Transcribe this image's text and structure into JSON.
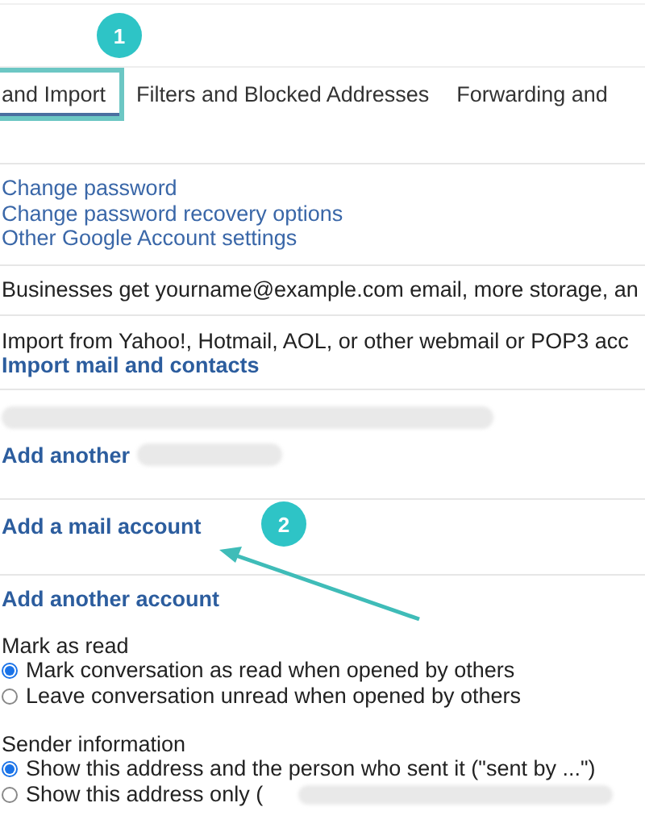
{
  "annotations": [
    {
      "label": "1"
    },
    {
      "label": "2"
    }
  ],
  "tabs": [
    {
      "label": "and Import",
      "selected": true
    },
    {
      "label": "Filters and Blocked Addresses",
      "selected": false
    },
    {
      "label": "Forwarding and",
      "selected": false
    }
  ],
  "account_links": [
    "Change password",
    "Change password recovery options",
    "Other Google Account settings"
  ],
  "business_text": "Businesses get yourname@example.com email, more storage, an",
  "import": {
    "text": "Import from Yahoo!, Hotmail, AOL, or other webmail or POP3 acc",
    "link": "Import mail and contacts"
  },
  "send_mail_as": {
    "link": "Add another"
  },
  "check_mail": {
    "link": "Add a mail account"
  },
  "grant_access": {
    "link": "Add another account",
    "groups": [
      {
        "title": "Mark as read",
        "options": [
          {
            "label": "Mark conversation as read when opened by others",
            "selected": true
          },
          {
            "label": "Leave conversation unread when opened by others",
            "selected": false
          }
        ]
      },
      {
        "title": "Sender information",
        "options": [
          {
            "label": "Show this address and the person who sent it (\"sent by ...\")",
            "selected": true
          },
          {
            "label": "Show this address only (",
            "selected": false
          }
        ]
      }
    ]
  }
}
